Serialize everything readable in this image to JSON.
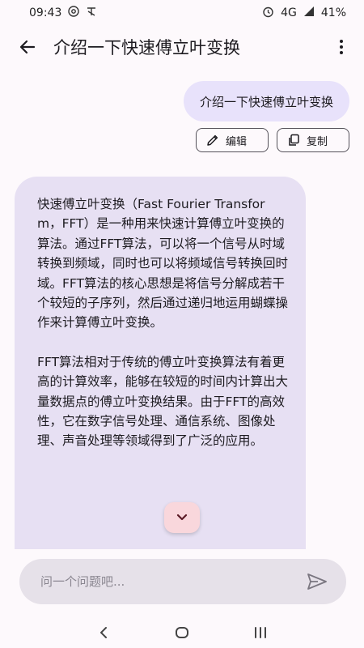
{
  "status_bar": {
    "time": "09:43",
    "network": "4G",
    "battery": "41%",
    "icons": [
      "at-sign-icon",
      "app-notification-icon",
      "alarm-icon",
      "signal-icon"
    ]
  },
  "app_bar": {
    "title": "介绍一下快速傅立叶变换",
    "back_icon": "arrow-left-icon",
    "more_icon": "more-vertical-icon"
  },
  "conversation": {
    "user_message": "介绍一下快速傅立叶变换",
    "actions": {
      "edit_label": "编辑",
      "copy_label": "复制"
    },
    "bot_message": {
      "paragraph_1": "快速傅立叶变换（Fast Fourier Transform，FFT）是一种用来快速计算傅立叶变换的算法。通过FFT算法，可以将一个信号从时域转换到频域，同时也可以将频域信号转换回时域。FFT算法的核心思想是将信号分解成若干个较短的子序列，然后通过递归地运用蝴蝶操作来计算傅立叶变换。",
      "paragraph_2": "FFT算法相对于传统的傅立叶变换算法有着更高的计算效率，能够在较短的时间内计算出大量数据点的傅立叶变换结果。由于FFT的高效性，它在数字信号处理、通信系统、图像处理、声音处理等领域得到了广泛的应用。"
    }
  },
  "composer": {
    "placeholder": "问一个问题吧...",
    "value": "",
    "send_icon": "send-icon"
  },
  "colors": {
    "background": "#fdf9fc",
    "user_bubble": "#e8e2fb",
    "bot_bubble": "#e7e0f3",
    "input_bar": "#e6e1e9",
    "scroll_button": "#f9d7dc"
  }
}
